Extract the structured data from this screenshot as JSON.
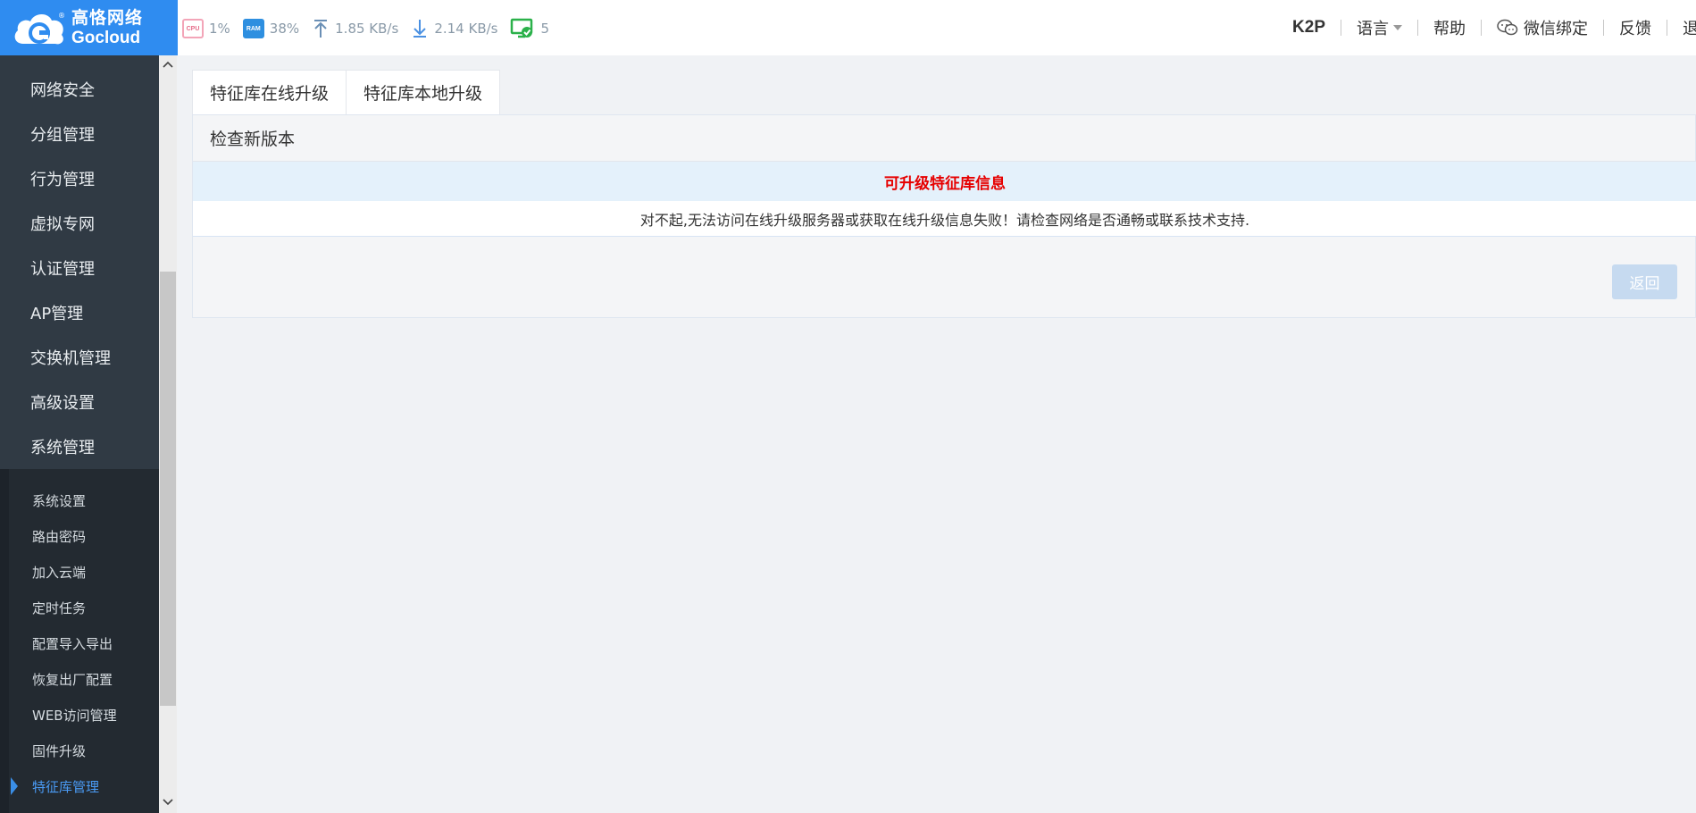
{
  "brand": {
    "name_cn": "高恪网络",
    "name_en": "Gocloud",
    "reg_mark": "®"
  },
  "stats": {
    "cpu_chip": "CPU",
    "cpu_value": "1%",
    "ram_chip": "RAM",
    "ram_value": "38%",
    "upload_value": "1.85 KB/s",
    "download_value": "2.14 KB/s",
    "online_value": "5"
  },
  "nav": {
    "model": "K2P",
    "language": "语言",
    "help": "帮助",
    "wechat": "微信绑定",
    "feedback": "反馈",
    "logout": "退出"
  },
  "sidebar": {
    "items": [
      {
        "label": "网络安全"
      },
      {
        "label": "分组管理"
      },
      {
        "label": "行为管理"
      },
      {
        "label": "虚拟专网"
      },
      {
        "label": "认证管理"
      },
      {
        "label": "AP管理"
      },
      {
        "label": "交换机管理"
      },
      {
        "label": "高级设置"
      },
      {
        "label": "系统管理"
      }
    ],
    "subitems": [
      {
        "label": "系统设置"
      },
      {
        "label": "路由密码"
      },
      {
        "label": "加入云端"
      },
      {
        "label": "定时任务"
      },
      {
        "label": "配置导入导出"
      },
      {
        "label": "恢复出厂配置"
      },
      {
        "label": "WEB访问管理"
      },
      {
        "label": "固件升级"
      },
      {
        "label": "特征库管理"
      }
    ]
  },
  "tabs": [
    {
      "label": "特征库在线升级"
    },
    {
      "label": "特征库本地升级"
    }
  ],
  "panel": {
    "title": "检查新版本",
    "table_header": "可升级特征库信息",
    "message": "对不起,无法访问在线升级服务器或获取在线升级信息失败！请检查网络是否通畅或联系技术支持.",
    "back_button": "返回"
  },
  "colors": {
    "brand_blue": "#2f8cf0",
    "sidebar_bg": "#303a44",
    "submenu_bg": "#232a31",
    "active_blue": "#4a9bf5",
    "error_red": "#e60000"
  }
}
